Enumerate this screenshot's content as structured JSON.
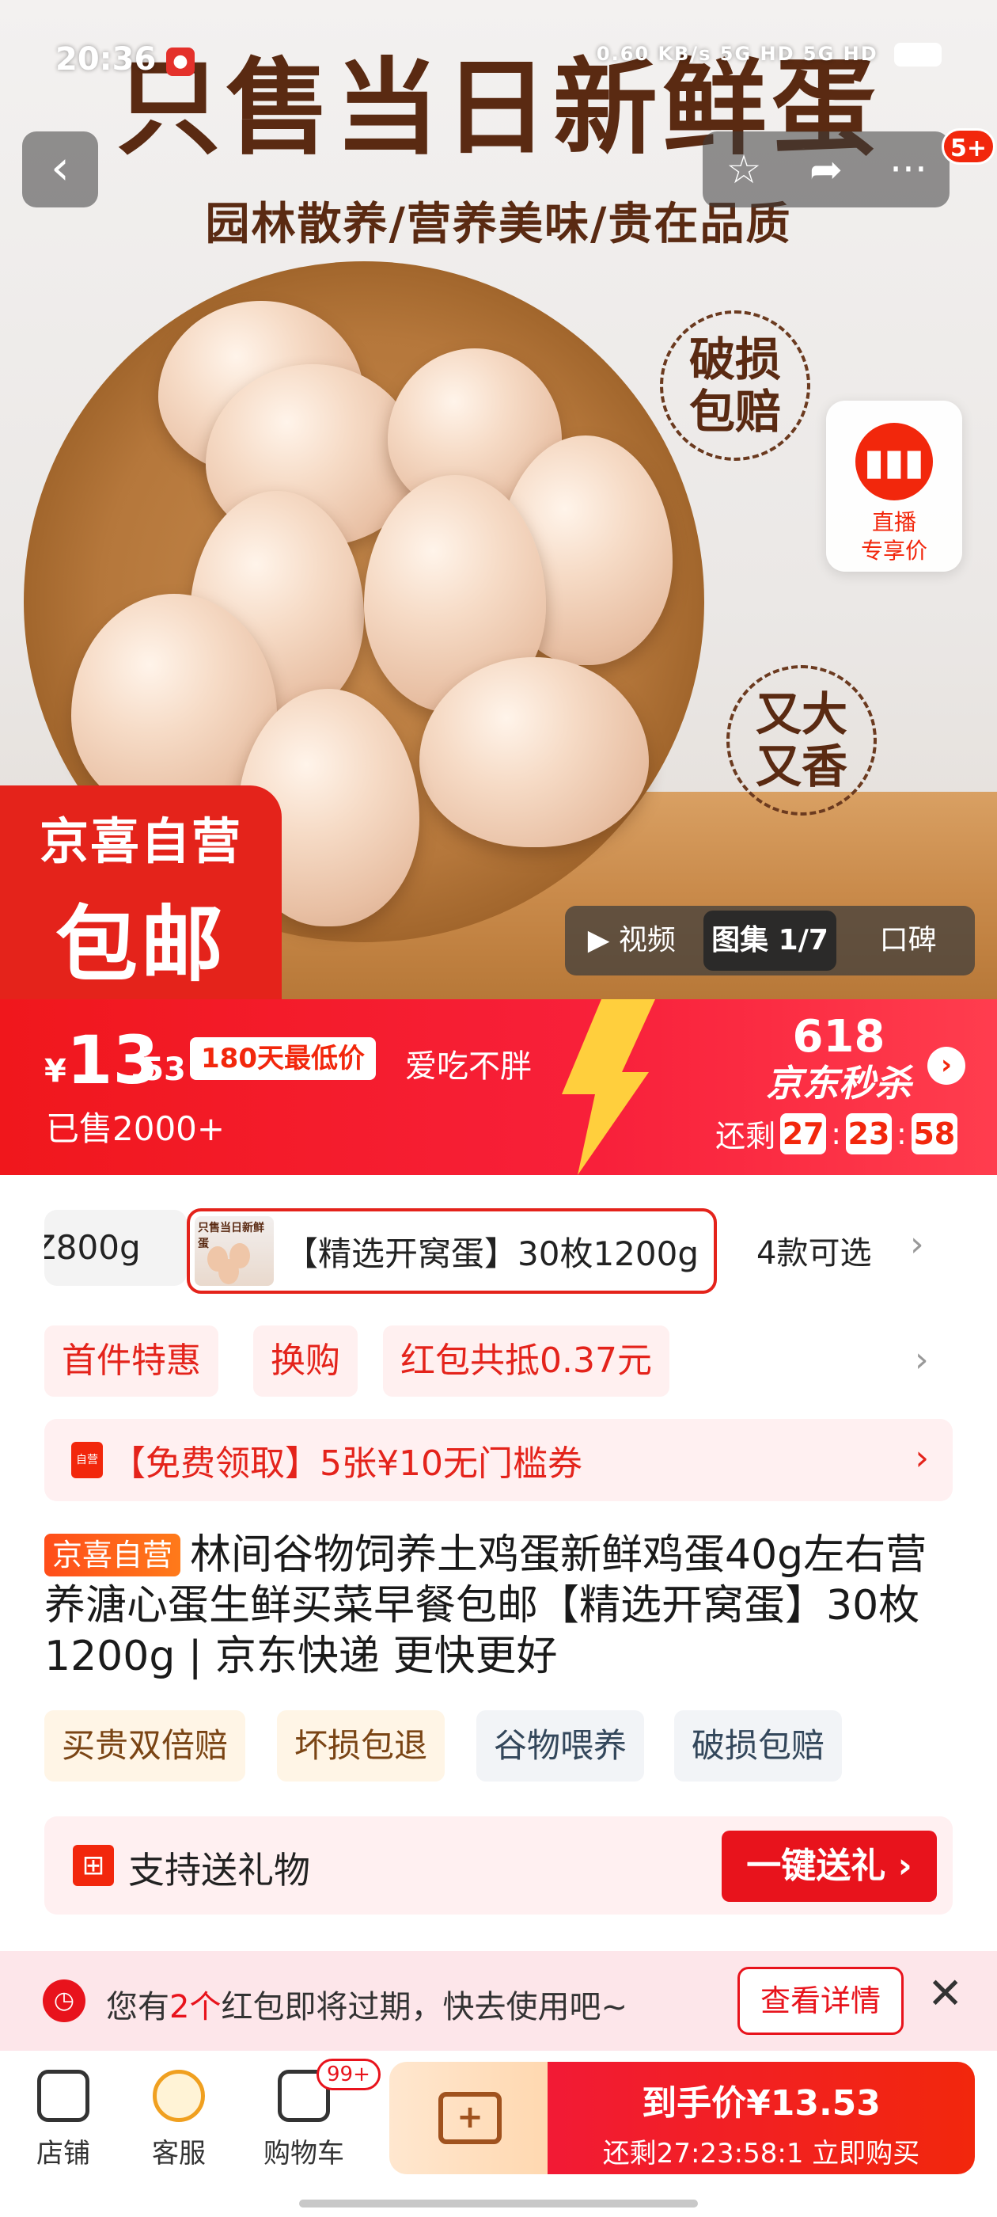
{
  "status_bar": {
    "time": "20:36",
    "network_speed": "0.60 KB/s",
    "signal": "5G HD 5G HD"
  },
  "hero": {
    "title": "只售当日新鲜蛋",
    "subtitle": "园林散养/营养美味/贵在品质",
    "badges": [
      "破损包赔",
      "又大又香"
    ],
    "promo_top": "京喜自营",
    "promo_bottom": "包邮",
    "live_label": "直播",
    "live_sub": "专享价",
    "media_tabs": [
      "▶ 视频",
      "图集 1/7",
      "口碑"
    ],
    "nav_badge": "5+"
  },
  "price": {
    "yen": "¥",
    "integer": "13",
    "decimal": ".53",
    "lowest_tag": "180天最低价",
    "slogan": "爱吃不胖",
    "sold": "已售2000+",
    "seckill_618": "618",
    "seckill_name": "京东秒杀",
    "remain_label": "还剩",
    "countdown": [
      "27",
      "23",
      "58"
    ]
  },
  "sku": {
    "partial": "Z800g",
    "selected": "【精选开窝蛋】30枚1200g",
    "thumb_title": "只售当日新鲜蛋",
    "count": "4款可选"
  },
  "promo_tags": [
    "首件特惠",
    "换购",
    "红包共抵0.37元"
  ],
  "coupon": {
    "icon_text": "自营",
    "text": "【免费领取】5张¥10无门槛券"
  },
  "product": {
    "self_tag": "京喜自营",
    "title": "林间谷物饲养土鸡蛋新鲜鸡蛋40g左右营养溏心蛋生鲜买菜早餐包邮【精选开窝蛋】30枚1200g | 京东快递 更快更好"
  },
  "service_tags": [
    "买贵双倍赔",
    "坏损包退",
    "谷物喂养",
    "破损包赔"
  ],
  "gift": {
    "text": "支持送礼物",
    "button": "一键送礼 ›"
  },
  "notice": {
    "pre": "您有",
    "count": "2个",
    "post": "红包即将过期，快去使用吧~",
    "button": "查看详情"
  },
  "bottom_bar": {
    "store": "店铺",
    "service": "客服",
    "cart": "购物车",
    "cart_badge": "99+",
    "buy_line1": "到手价¥13.53",
    "buy_line2": "还剩27:23:58:1  立即购买"
  },
  "colors": {
    "brand_red": "#f2270c",
    "promo_red": "#e4231b",
    "egg_brown": "#5a2a12"
  }
}
